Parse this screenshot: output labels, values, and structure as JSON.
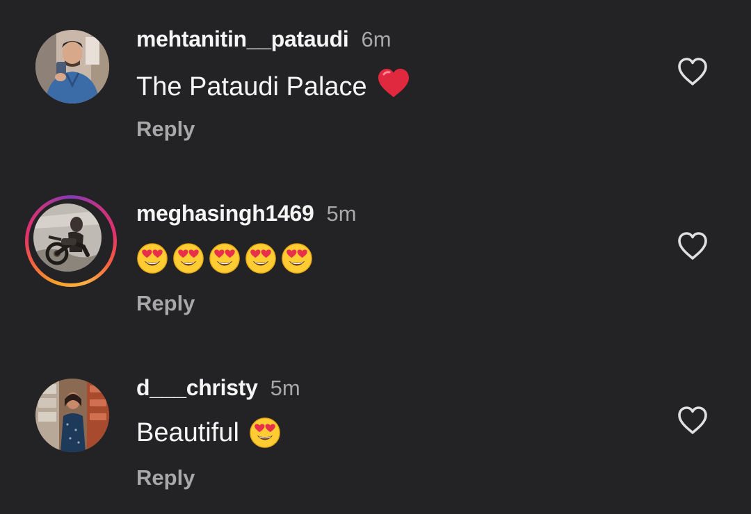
{
  "comments": [
    {
      "username": "mehtanitin__pataudi",
      "time": "6m",
      "text": "The Pataudi Palace",
      "emoji": "red-heart",
      "reply_label": "Reply",
      "has_story_ring": false
    },
    {
      "username": "meghasingh1469",
      "time": "5m",
      "text": "",
      "emoji": "heart-eyes x5",
      "reply_label": "Reply",
      "has_story_ring": true
    },
    {
      "username": "d___christy",
      "time": "5m",
      "text": "Beautiful",
      "emoji": "heart-eyes",
      "reply_label": "Reply",
      "has_story_ring": false
    }
  ],
  "colors": {
    "background": "#232224",
    "primary_text": "#f5f5f5",
    "secondary_text": "#a8a8a8",
    "like_icon": "#e0e0e0"
  }
}
